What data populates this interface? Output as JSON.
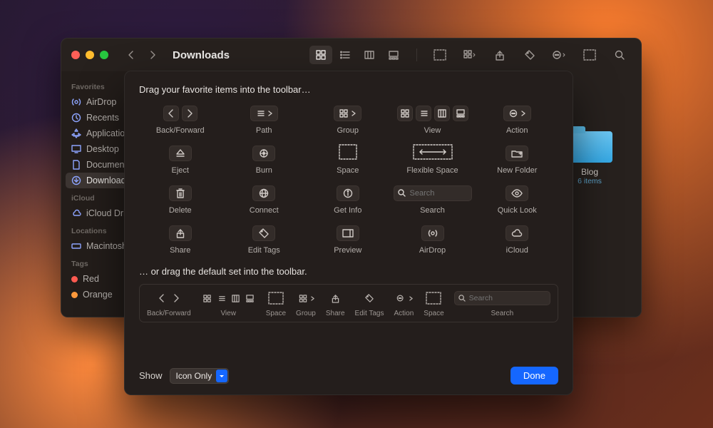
{
  "window": {
    "title": "Downloads"
  },
  "sidebar": {
    "sections": [
      {
        "header": "Favorites",
        "items": [
          {
            "icon": "airdrop",
            "label": "AirDrop"
          },
          {
            "icon": "recents",
            "label": "Recents"
          },
          {
            "icon": "apps",
            "label": "Applications"
          },
          {
            "icon": "desktop",
            "label": "Desktop"
          },
          {
            "icon": "doc",
            "label": "Documents"
          },
          {
            "icon": "downloads",
            "label": "Downloads",
            "selected": true
          }
        ]
      },
      {
        "header": "iCloud",
        "items": [
          {
            "icon": "cloud",
            "label": "iCloud Drive"
          }
        ]
      },
      {
        "header": "Locations",
        "items": [
          {
            "icon": "disk",
            "label": "Macintosh HD"
          }
        ]
      },
      {
        "header": "Tags",
        "items": [
          {
            "icon": "dot",
            "label": "Red",
            "color": "#ff5b51"
          },
          {
            "icon": "dot",
            "label": "Orange",
            "color": "#ff9a3c"
          }
        ]
      }
    ]
  },
  "content": {
    "folder_name": "Blog",
    "folder_meta": "6 items"
  },
  "sheet": {
    "heading": "Drag your favorite items into the toolbar…",
    "palette": [
      {
        "id": "back-forward",
        "label": "Back/Forward"
      },
      {
        "id": "path",
        "label": "Path"
      },
      {
        "id": "group",
        "label": "Group"
      },
      {
        "id": "view",
        "label": "View"
      },
      {
        "id": "action",
        "label": "Action"
      },
      {
        "id": "eject",
        "label": "Eject"
      },
      {
        "id": "burn",
        "label": "Burn"
      },
      {
        "id": "space",
        "label": "Space"
      },
      {
        "id": "flexible-space",
        "label": "Flexible Space"
      },
      {
        "id": "new-folder",
        "label": "New Folder"
      },
      {
        "id": "delete",
        "label": "Delete"
      },
      {
        "id": "connect",
        "label": "Connect"
      },
      {
        "id": "get-info",
        "label": "Get Info"
      },
      {
        "id": "search",
        "label": "Search",
        "placeholder": "Search"
      },
      {
        "id": "quick-look",
        "label": "Quick Look"
      },
      {
        "id": "share",
        "label": "Share"
      },
      {
        "id": "edit-tags",
        "label": "Edit Tags"
      },
      {
        "id": "preview",
        "label": "Preview"
      },
      {
        "id": "airdrop",
        "label": "AirDrop"
      },
      {
        "id": "icloud",
        "label": "iCloud"
      }
    ],
    "sub_heading": "… or drag the default set into the toolbar.",
    "default_set": [
      {
        "id": "back-forward",
        "label": "Back/Forward"
      },
      {
        "id": "view",
        "label": "View"
      },
      {
        "id": "space",
        "label": "Space"
      },
      {
        "id": "group",
        "label": "Group"
      },
      {
        "id": "share",
        "label": "Share"
      },
      {
        "id": "edit-tags",
        "label": "Edit Tags"
      },
      {
        "id": "action",
        "label": "Action"
      },
      {
        "id": "space2",
        "label": "Space"
      },
      {
        "id": "search",
        "label": "Search",
        "placeholder": "Search"
      }
    ],
    "show_label": "Show",
    "show_value": "Icon Only",
    "done_label": "Done"
  }
}
